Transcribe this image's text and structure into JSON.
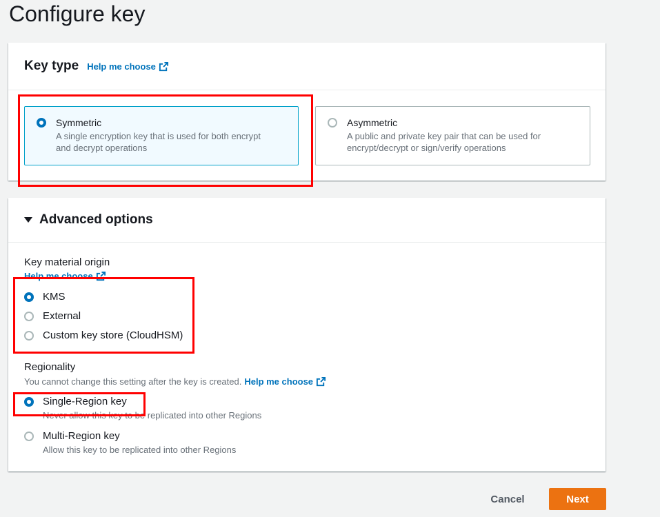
{
  "page": {
    "title": "Configure key"
  },
  "key_type": {
    "title": "Key type",
    "help_link": "Help me choose",
    "options": [
      {
        "label": "Symmetric",
        "desc_line1": "A single encryption key that is used for both encrypt",
        "desc_line2": "and decrypt operations",
        "selected": true
      },
      {
        "label": "Asymmetric",
        "desc_line1": "A public and private key pair that can be used for",
        "desc_line2": "encrypt/decrypt or sign/verify operations",
        "selected": false
      }
    ]
  },
  "advanced": {
    "title": "Advanced options",
    "expanded": true,
    "key_material": {
      "label": "Key material origin",
      "help_link": "Help me choose",
      "options": [
        {
          "label": "KMS",
          "selected": true
        },
        {
          "label": "External",
          "selected": false
        },
        {
          "label": "Custom key store (CloudHSM)",
          "selected": false
        }
      ]
    },
    "regionality": {
      "label": "Regionality",
      "description": "You cannot change this setting after the key is created.",
      "help_link": "Help me choose",
      "options": [
        {
          "label": "Single-Region key",
          "desc": "Never allow this key to be replicated into other Regions",
          "selected": true
        },
        {
          "label": "Multi-Region key",
          "desc": "Allow this key to be replicated into other Regions",
          "selected": false
        }
      ]
    }
  },
  "footer": {
    "cancel_label": "Cancel",
    "next_label": "Next"
  },
  "colors": {
    "accent": "#0073bb",
    "primary_button": "#ec7211",
    "highlight": "#ff0000",
    "selected_tile_border": "#00a1c9"
  },
  "icons": {
    "external_link": "external-link-icon",
    "expand": "caret-down-icon"
  }
}
